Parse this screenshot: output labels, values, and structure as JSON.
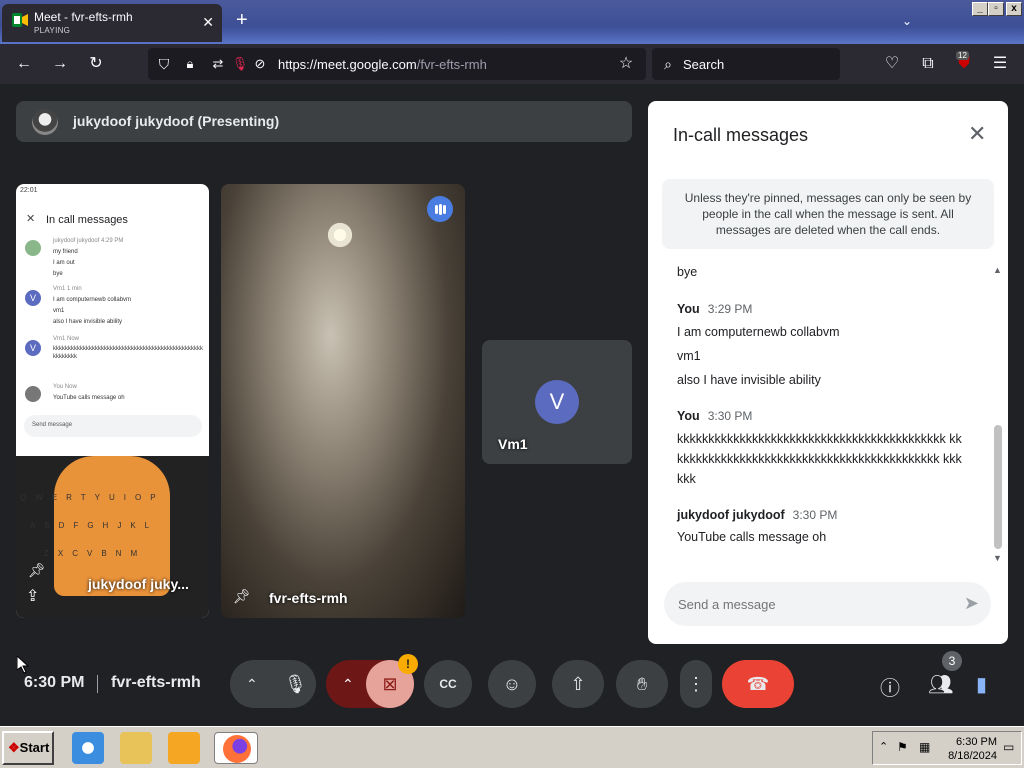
{
  "browser": {
    "tab_title": "Meet - fvr-efts-rmh",
    "tab_status": "PLAYING",
    "url_host": "https://meet.google.com",
    "url_path": "/fvr-efts-rmh",
    "search_placeholder": "Search",
    "badge_count": "12"
  },
  "meet": {
    "presenting_label": "jukydoof jukydoof (Presenting)",
    "tiles": {
      "presenter_name": "jukydoof juky...",
      "camera_name": "fvr-efts-rmh",
      "vm1_initial": "V",
      "vm1_name": "Vm1"
    },
    "phone": {
      "status_time": "22:01",
      "title": "In call messages",
      "msg1_sender": "jukydoof jukydoof 4:29 PM",
      "msg1_lines": [
        "my friend",
        "I am out",
        "bye"
      ],
      "msg2_sender": "Vm1 1 min",
      "msg2_lines": [
        "I am computernewb collabvm",
        "vm1",
        "also I have invisible ability"
      ],
      "msg3_sender": "Vm1 Now",
      "msg3_line": "kkkkkkkkkkkkkkkkkkkkkkkkkkkkkkkkkkkkkkkkkkkkkkkkkkkkkkkkkk",
      "msg4_sender": "You Now",
      "msg4_line": "YouTube calls message oh",
      "input_placeholder": "Send message",
      "keys_row1": "QWERTYUIOP",
      "keys_row2": "ASDFGHJKL",
      "keys_row3": "ZXCVBNM"
    },
    "panel": {
      "title": "In-call messages",
      "notice": "Unless they're pinned, messages can only be seen by people in the call when the message is sent. All messages are deleted when the call ends.",
      "messages": [
        {
          "text": "bye"
        },
        {
          "sender": "You",
          "time": "3:29 PM",
          "lines": [
            "I am computernewb collabvm",
            "vm1",
            "also I have invisible ability"
          ]
        },
        {
          "sender": "You",
          "time": "3:30 PM",
          "lines": [
            "kkkkkkkkkkkkkkkkkkkkkkkkkkkkkkkkkkkkkkkkkkk kkkkkkkkkkkkkkkkkkkkkkkkkkkkkkkkkkkkkkkkkkkk kkkkkk"
          ]
        },
        {
          "sender": "jukydoof jukydoof",
          "time": "3:30 PM",
          "lines": [
            "YouTube calls message oh"
          ]
        }
      ],
      "input_placeholder": "Send a message"
    },
    "bottom": {
      "time": "6:30 PM",
      "meeting_code": "fvr-efts-rmh",
      "camera_warning": "!",
      "people_count": "3"
    }
  },
  "taskbar": {
    "start_label": "Start",
    "clock_time": "6:30 PM",
    "clock_date": "8/18/2024"
  },
  "icons": [
    "speaker-icon",
    "close-icon",
    "plus-icon",
    "chevron-down-icon",
    "back-icon",
    "forward-icon",
    "reload-icon",
    "shield-icon",
    "lock-icon",
    "permissions-icon",
    "mic-off-icon",
    "tracking-off-icon",
    "star-icon",
    "search-icon",
    "pocket-icon",
    "extensions-icon",
    "ublock-icon",
    "menu-icon"
  ],
  "colors": {
    "meet_bg": "#202124",
    "hangup": "#ea4335",
    "avatar": "#5b6bc0",
    "accent": "#4a7de2"
  }
}
